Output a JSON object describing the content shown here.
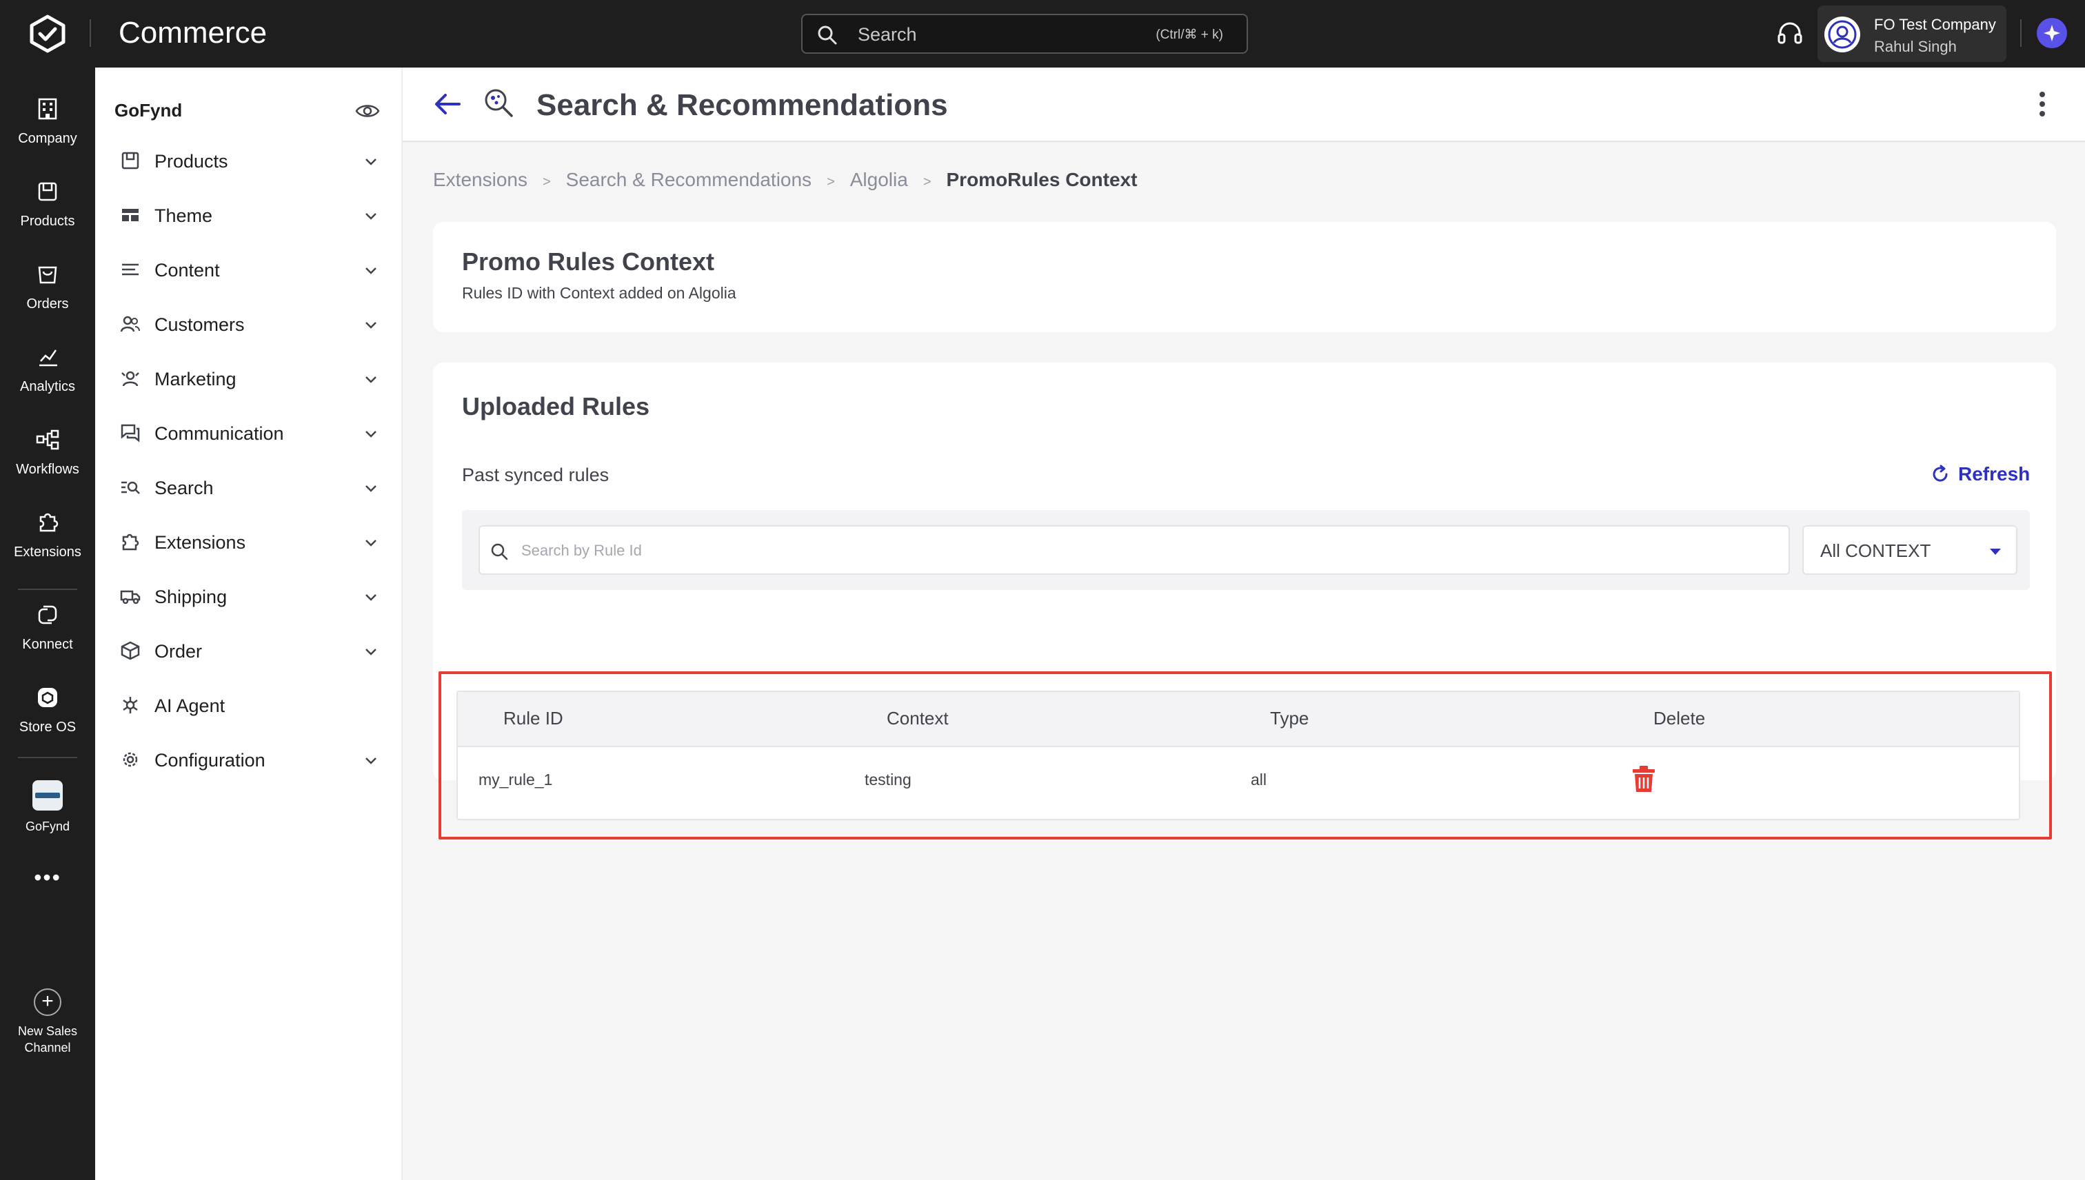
{
  "topbar": {
    "app_title": "Commerce",
    "search_placeholder": "Search",
    "search_shortcut": "(Ctrl/⌘ + k)",
    "company_name": "FO Test Company",
    "user_name": "Rahul Singh"
  },
  "rail": {
    "items": [
      {
        "label": "Company",
        "icon": "building-icon"
      },
      {
        "label": "Products",
        "icon": "box-icon"
      },
      {
        "label": "Orders",
        "icon": "cart-icon"
      },
      {
        "label": "Analytics",
        "icon": "chart-icon"
      },
      {
        "label": "Workflows",
        "icon": "workflow-icon"
      },
      {
        "label": "Extensions",
        "icon": "puzzle-icon"
      },
      {
        "label": "Konnect",
        "icon": "konnect-icon"
      },
      {
        "label": "Store OS",
        "icon": "store-os-icon"
      },
      {
        "label": "GoFynd",
        "icon": "gofynd-thumbnail"
      }
    ],
    "more": "•••",
    "new_sales_channel_line1": "New Sales",
    "new_sales_channel_line2": "Channel"
  },
  "sidebar": {
    "title": "GoFynd",
    "items": [
      {
        "label": "Products",
        "icon": "box-icon",
        "expandable": true
      },
      {
        "label": "Theme",
        "icon": "theme-icon",
        "expandable": true
      },
      {
        "label": "Content",
        "icon": "content-icon",
        "expandable": true
      },
      {
        "label": "Customers",
        "icon": "users-icon",
        "expandable": true
      },
      {
        "label": "Marketing",
        "icon": "marketing-icon",
        "expandable": true
      },
      {
        "label": "Communication",
        "icon": "chat-icon",
        "expandable": true
      },
      {
        "label": "Search",
        "icon": "search-list-icon",
        "expandable": true
      },
      {
        "label": "Extensions",
        "icon": "puzzle-icon",
        "expandable": true
      },
      {
        "label": "Shipping",
        "icon": "truck-icon",
        "expandable": true
      },
      {
        "label": "Order",
        "icon": "package-icon",
        "expandable": true
      },
      {
        "label": "AI Agent",
        "icon": "ai-agent-icon",
        "expandable": false
      },
      {
        "label": "Configuration",
        "icon": "gear-icon",
        "expandable": true
      }
    ]
  },
  "page": {
    "title": "Search & Recommendations",
    "breadcrumb": [
      "Extensions",
      "Search & Recommendations",
      "Algolia",
      "PromoRules Context"
    ],
    "breadcrumb_separator": ">"
  },
  "context_card": {
    "title": "Promo Rules Context",
    "subtitle": "Rules ID with Context added on Algolia"
  },
  "rules_card": {
    "title": "Uploaded Rules",
    "subtitle": "Past synced rules",
    "refresh_label": "Refresh",
    "search_placeholder": "Search by Rule Id",
    "context_filter_value": "All CONTEXT",
    "columns": [
      "Rule ID",
      "Context",
      "Type",
      "Delete"
    ],
    "rows": [
      {
        "rule_id": "my_rule_1",
        "context": "testing",
        "type": "all"
      }
    ]
  },
  "colors": {
    "topbar_bg": "#1e1e1e",
    "accent": "#2e31be",
    "highlight_border": "#e63c33",
    "delete_icon": "#e63c33"
  }
}
